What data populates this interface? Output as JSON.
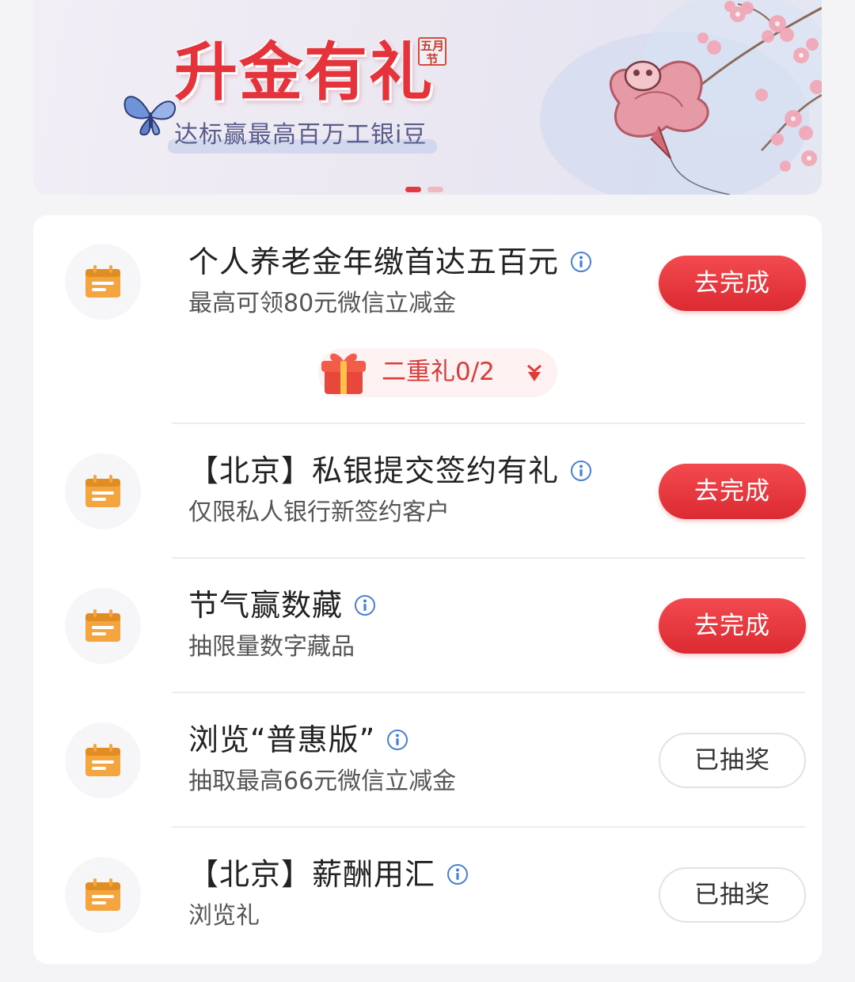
{
  "banner": {
    "title": "升金有礼",
    "seal_text": "五月\n节",
    "subtitle": "达标赢最高百万工银i豆",
    "page_indicator": {
      "total": 2,
      "active": 1
    }
  },
  "tasks": [
    {
      "title": "个人养老金年缴首达五百元",
      "subtitle": "最高可领80元微信立减金",
      "button": "去完成",
      "button_state": "active",
      "bonus": "二重礼0/2"
    },
    {
      "title": "【北京】私银提交签约有礼",
      "subtitle": "仅限私人银行新签约客户",
      "button": "去完成",
      "button_state": "active"
    },
    {
      "title": "节气赢数藏",
      "subtitle": "抽限量数字藏品",
      "button": "去完成",
      "button_state": "active"
    },
    {
      "title": "浏览“普惠版”",
      "subtitle": "抽取最高66元微信立减金",
      "button": "已抽奖",
      "button_state": "done"
    },
    {
      "title": "【北京】薪酬用汇",
      "subtitle": "浏览礼",
      "button": "已抽奖",
      "button_state": "done"
    }
  ],
  "icons": {
    "task_icon": "calendar-icon",
    "info_icon": "info-icon",
    "bonus_icon": "gift-icon",
    "expand_icon": "chevron-down-icon"
  },
  "colors": {
    "brand_red": "#e23a42",
    "task_icon_orange": "#f4a540"
  }
}
